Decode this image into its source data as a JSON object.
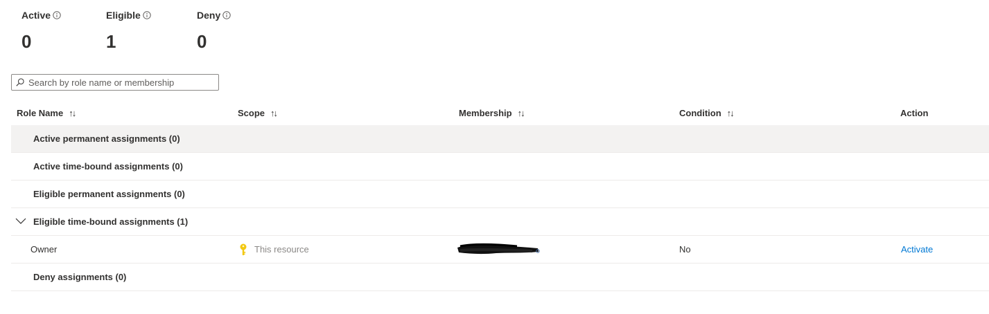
{
  "summary": {
    "active": {
      "label": "Active",
      "value": "0"
    },
    "eligible": {
      "label": "Eligible",
      "value": "1"
    },
    "deny": {
      "label": "Deny",
      "value": "0"
    }
  },
  "search": {
    "placeholder": "Search by role name or membership"
  },
  "columns": {
    "role_name": "Role Name",
    "scope": "Scope",
    "membership": "Membership",
    "condition": "Condition",
    "action": "Action"
  },
  "groups": {
    "active_permanent": "Active permanent assignments (0)",
    "active_time_bound": "Active time-bound assignments (0)",
    "eligible_permanent": "Eligible permanent assignments (0)",
    "eligible_time_bound": "Eligible time-bound assignments (1)",
    "deny": "Deny assignments (0)"
  },
  "eligible_row": {
    "role": "Owner",
    "scope": "This resource",
    "condition": "No",
    "action": "Activate"
  },
  "icons": {
    "info": "info-icon",
    "search": "search-icon",
    "sort": "sort-icon",
    "chevron": "chevron-down-icon",
    "key": "key-icon"
  },
  "colors": {
    "link": "#0078d4",
    "key": "#f2c811",
    "selected_row": "#f3f2f1"
  }
}
